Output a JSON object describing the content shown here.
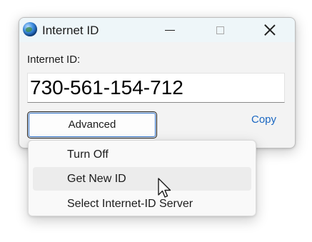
{
  "window": {
    "title": "Internet ID",
    "icon": "globe-icon",
    "controls": {
      "minimize": "minimize-icon",
      "maximize": "maximize-icon",
      "close": "close-icon"
    }
  },
  "main": {
    "id_label": "Internet ID:",
    "id_value": "730-561-154-712",
    "advanced_label": "Advanced",
    "copy_label": "Copy"
  },
  "menu": {
    "items": [
      {
        "label": "Turn Off"
      },
      {
        "label": "Get New ID",
        "hovered": true
      },
      {
        "label": "Select Internet-ID Server"
      }
    ]
  },
  "colors": {
    "titlebar": "#eef6f9",
    "link": "#1a67c2",
    "focus_border": "#2a6cc4",
    "hover": "#ececec"
  }
}
